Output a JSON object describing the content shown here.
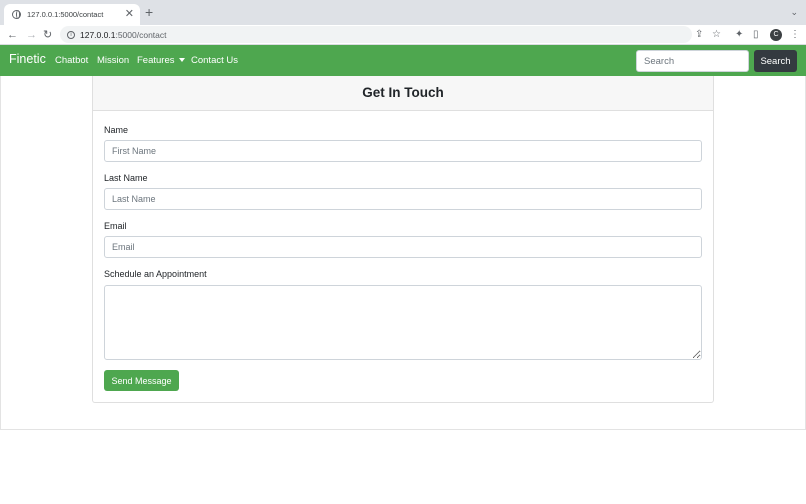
{
  "browser": {
    "tab_title": "127.0.0.1:5000/contact",
    "tab_close": "✕",
    "new_tab": "+",
    "tab_overflow": "⌄",
    "url_host": "127.0.0.1",
    "url_path": ":5000/contact",
    "back_icon": "←",
    "forward_icon": "→",
    "reload_icon": "↻",
    "info_icon": "i",
    "share_icon": "⇪",
    "bookmark_icon": "☆",
    "extensions_icon": "✦",
    "sidepanel_icon": "▯",
    "profile_initial": "C",
    "menu_icon": "⋮"
  },
  "navbar": {
    "brand": "Finetic",
    "links": [
      "Chatbot",
      "Mission",
      "Features",
      "Contact Us"
    ],
    "search_placeholder": "Search",
    "search_button": "Search",
    "color": "#4ea74f"
  },
  "form": {
    "title": "Get In Touch",
    "fields": [
      {
        "label": "Name",
        "placeholder": "First Name"
      },
      {
        "label": "Last Name",
        "placeholder": "Last Name"
      },
      {
        "label": "Email",
        "placeholder": "Email"
      }
    ],
    "appointment_label": "Schedule an Appointment",
    "submit_label": "Send Message"
  }
}
